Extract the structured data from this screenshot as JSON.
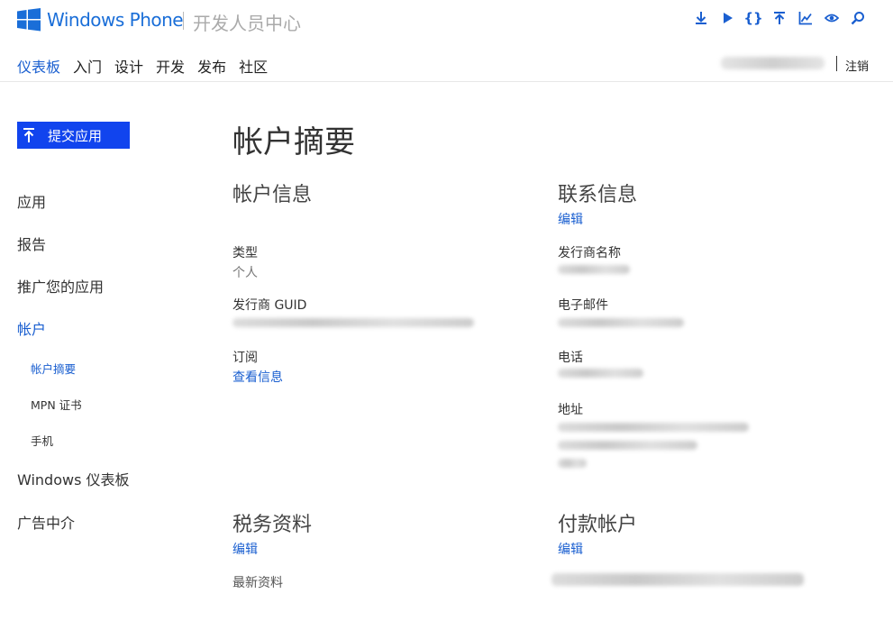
{
  "brand": {
    "product": "Windows Phone",
    "subtitle": "开发人员中心"
  },
  "top_icons": [
    "download-icon",
    "play-icon",
    "code-braces-icon",
    "upload-icon",
    "chart-icon",
    "eye-icon",
    "search-icon"
  ],
  "nav": {
    "items": [
      {
        "label": "仪表板",
        "active": true
      },
      {
        "label": "入门"
      },
      {
        "label": "设计"
      },
      {
        "label": "开发"
      },
      {
        "label": "发布"
      },
      {
        "label": "社区"
      }
    ],
    "logout": "注销"
  },
  "sidebar": {
    "submit": "提交应用",
    "items": [
      {
        "label": "应用"
      },
      {
        "label": "报告"
      },
      {
        "label": "推广您的应用"
      },
      {
        "label": "帐户",
        "active": true
      },
      {
        "label": "帐户摘要",
        "sub": true,
        "active": true
      },
      {
        "label": "MPN 证书",
        "sub": true
      },
      {
        "label": "手机",
        "sub": true
      },
      {
        "label": "Windows 仪表板"
      },
      {
        "label": "广告中介"
      }
    ]
  },
  "main": {
    "title": "帐户摘要",
    "account_info": {
      "heading": "帐户信息",
      "type_label": "类型",
      "type_value": "个人",
      "guid_label": "发行商 GUID",
      "subscription_label": "订阅",
      "subscription_link": "查看信息"
    },
    "contact_info": {
      "heading": "联系信息",
      "edit": "编辑",
      "publisher_label": "发行商名称",
      "email_label": "电子邮件",
      "phone_label": "电话",
      "address_label": "地址"
    },
    "tax": {
      "heading": "税务资料",
      "edit": "编辑",
      "latest": "最新资料"
    },
    "payout": {
      "heading": "付款帐户",
      "edit": "编辑"
    }
  }
}
